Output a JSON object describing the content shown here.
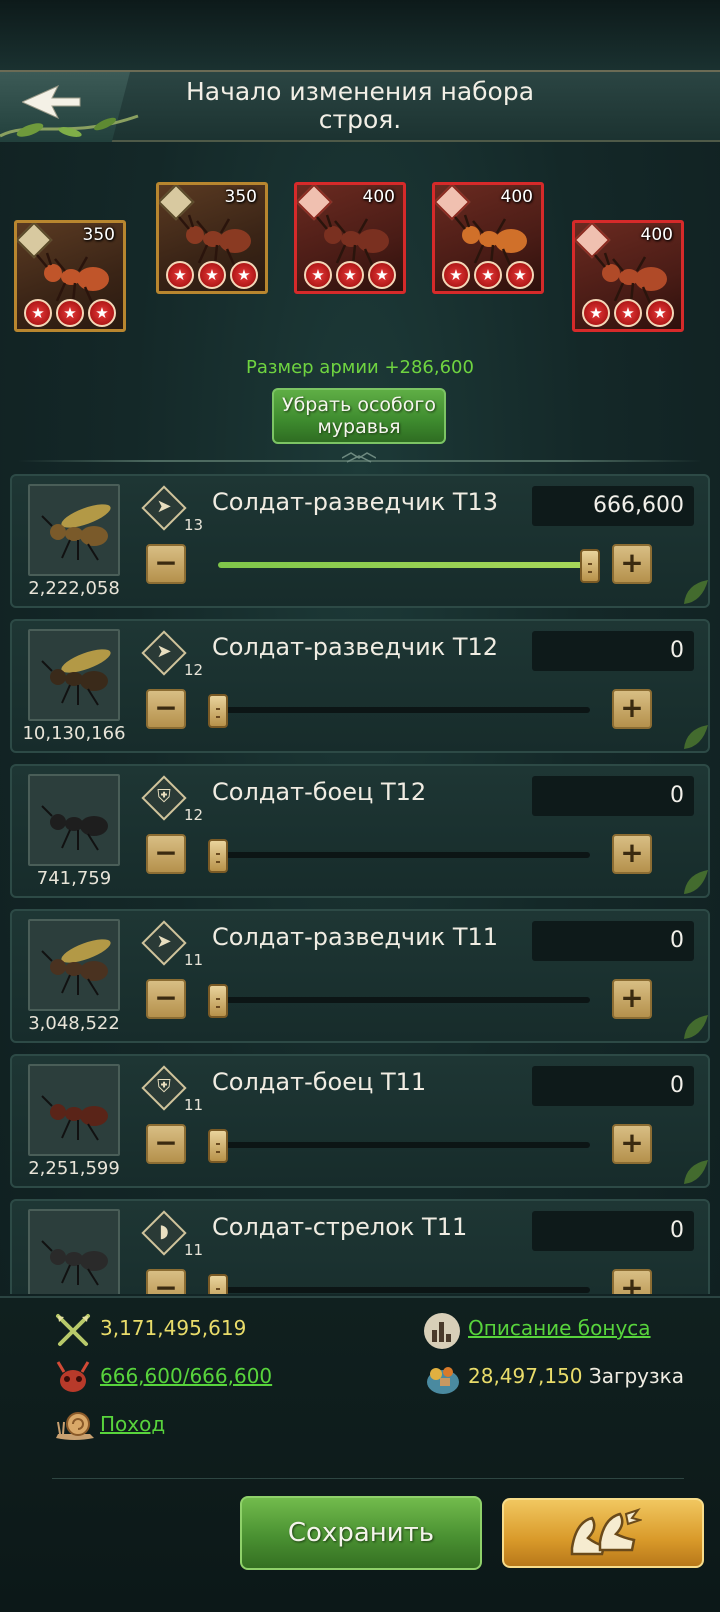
{
  "header": {
    "title": "Начало изменения набора строя."
  },
  "squad": [
    {
      "power": "350",
      "rarity": "gold",
      "stars": 3,
      "class_icon": "scout-icon"
    },
    {
      "power": "350",
      "rarity": "gold",
      "stars": 3,
      "class_icon": "scout-icon"
    },
    {
      "power": "400",
      "rarity": "red",
      "stars": 3,
      "class_icon": "scout-icon"
    },
    {
      "power": "400",
      "rarity": "red",
      "stars": 3,
      "class_icon": "archer-icon"
    },
    {
      "power": "400",
      "rarity": "red",
      "stars": 3,
      "class_icon": "scout-icon"
    }
  ],
  "army_size": "Размер армии +286,600",
  "remove_button": "Убрать особого муравья",
  "troops": [
    {
      "name": "Солдат-разведчик T13",
      "tier": "13",
      "count": "2,222,058",
      "qty": "666,600",
      "fill": 1.0,
      "class_icon": "scout-icon"
    },
    {
      "name": "Солдат-разведчик T12",
      "tier": "12",
      "count": "10,130,166",
      "qty": "0",
      "fill": 0,
      "class_icon": "scout-icon"
    },
    {
      "name": "Солдат-боец T12",
      "tier": "12",
      "count": "741,759",
      "qty": "0",
      "fill": 0,
      "class_icon": "shield-icon"
    },
    {
      "name": "Солдат-разведчик T11",
      "tier": "11",
      "count": "3,048,522",
      "qty": "0",
      "fill": 0,
      "class_icon": "scout-icon"
    },
    {
      "name": "Солдат-боец T11",
      "tier": "11",
      "count": "2,251,599",
      "qty": "0",
      "fill": 0,
      "class_icon": "shield-icon"
    },
    {
      "name": "Солдат-стрелок T11",
      "tier": "11",
      "count": "",
      "qty": "0",
      "fill": 0,
      "class_icon": "archer-icon"
    }
  ],
  "bottom": {
    "power": "3,171,495,619",
    "capacity": "666,600/666,600",
    "march": "Поход",
    "bonus": "Описание бонуса",
    "load_value": "28,497,150",
    "load_label": "Загрузка",
    "save": "Сохранить"
  },
  "colors": {
    "accent_green": "#58d43c",
    "gold": "#e9dc6a",
    "card_gold_border": "#b8862f",
    "card_red_border": "#d62a2a"
  }
}
